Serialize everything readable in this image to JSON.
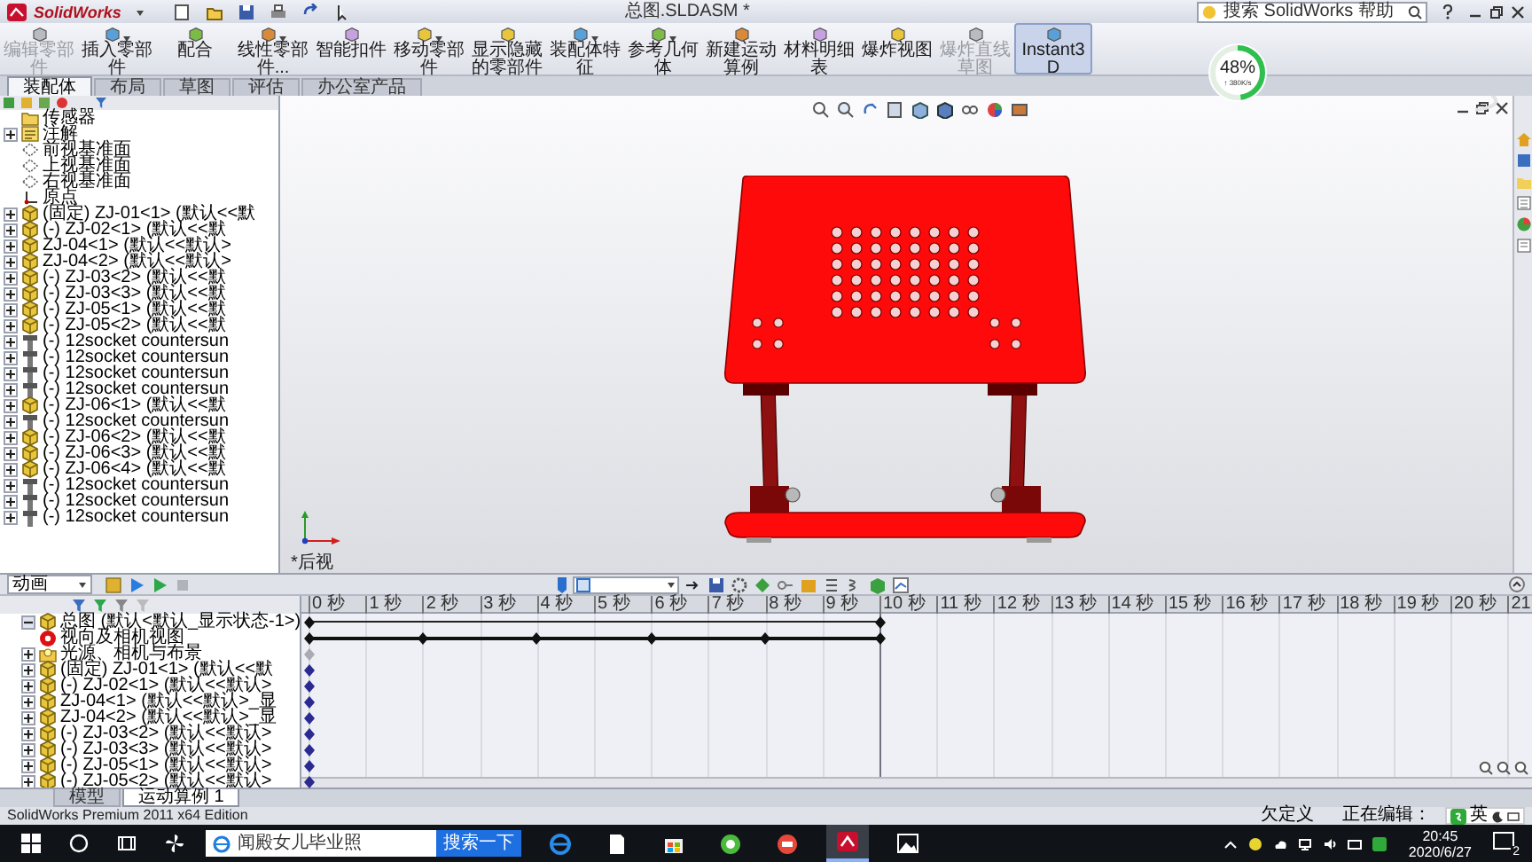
{
  "app": {
    "logo": "SolidWorks",
    "title": "总图.SLDASM *",
    "help_search": "搜索 SolidWorks 帮助"
  },
  "ribbon": [
    {
      "label": "编辑零部件",
      "disabled": true,
      "dropdown": false,
      "selected": false
    },
    {
      "label": "插入零部件",
      "disabled": false,
      "dropdown": true,
      "selected": false
    },
    {
      "label": "配合",
      "disabled": false,
      "dropdown": false,
      "selected": false
    },
    {
      "label": "线性零部件...",
      "disabled": false,
      "dropdown": true,
      "selected": false
    },
    {
      "label": "智能扣件",
      "disabled": false,
      "dropdown": false,
      "selected": false
    },
    {
      "label": "移动零部件",
      "disabled": false,
      "dropdown": true,
      "selected": false
    },
    {
      "label": "显示隐藏的零部件",
      "disabled": false,
      "dropdown": false,
      "selected": false
    },
    {
      "label": "装配体特征",
      "disabled": false,
      "dropdown": true,
      "selected": false
    },
    {
      "label": "参考几何体",
      "disabled": false,
      "dropdown": true,
      "selected": false
    },
    {
      "label": "新建运动算例",
      "disabled": false,
      "dropdown": false,
      "selected": false
    },
    {
      "label": "材料明细表",
      "disabled": false,
      "dropdown": false,
      "selected": false
    },
    {
      "label": "爆炸视图",
      "disabled": false,
      "dropdown": false,
      "selected": false
    },
    {
      "label": "爆炸直线草图",
      "disabled": true,
      "dropdown": false,
      "selected": false
    },
    {
      "label": "Instant3D",
      "disabled": false,
      "dropdown": false,
      "selected": true
    }
  ],
  "command_tabs": [
    {
      "label": "装配体",
      "selected": true
    },
    {
      "label": "布局",
      "selected": false
    },
    {
      "label": "草图",
      "selected": false
    },
    {
      "label": "评估",
      "selected": false
    },
    {
      "label": "办公室产品",
      "selected": false
    }
  ],
  "feature_tree": [
    {
      "label": "传感器",
      "kind": "folder",
      "expandable": false
    },
    {
      "label": "注解",
      "kind": "note",
      "expandable": true,
      "expanded": false
    },
    {
      "label": "前视基准面",
      "kind": "plane",
      "expandable": false
    },
    {
      "label": "上视基准面",
      "kind": "plane",
      "expandable": false
    },
    {
      "label": "右视基准面",
      "kind": "plane",
      "expandable": false
    },
    {
      "label": "原点",
      "kind": "origin",
      "expandable": false
    },
    {
      "label": "(固定) ZJ-01<1> (默认<<默",
      "kind": "part",
      "expandable": true,
      "expanded": false
    },
    {
      "label": "(-) ZJ-02<1> (默认<<默",
      "kind": "part",
      "expandable": true,
      "expanded": false
    },
    {
      "label": "ZJ-04<1> (默认<<默认>",
      "kind": "part",
      "expandable": true,
      "expanded": false
    },
    {
      "label": "ZJ-04<2> (默认<<默认>",
      "kind": "part",
      "expandable": true,
      "expanded": false
    },
    {
      "label": "(-) ZJ-03<2> (默认<<默",
      "kind": "part",
      "expandable": true,
      "expanded": false
    },
    {
      "label": "(-) ZJ-03<3> (默认<<默",
      "kind": "part",
      "expandable": true,
      "expanded": false
    },
    {
      "label": "(-) ZJ-05<1> (默认<<默",
      "kind": "part",
      "expandable": true,
      "expanded": false
    },
    {
      "label": "(-) ZJ-05<2> (默认<<默",
      "kind": "part",
      "expandable": true,
      "expanded": false
    },
    {
      "label": "(-) 12socket countersun",
      "kind": "fastener",
      "expandable": true,
      "expanded": false
    },
    {
      "label": "(-) 12socket countersun",
      "kind": "fastener",
      "expandable": true,
      "expanded": false
    },
    {
      "label": "(-) 12socket countersun",
      "kind": "fastener",
      "expandable": true,
      "expanded": false
    },
    {
      "label": "(-) 12socket countersun",
      "kind": "fastener",
      "expandable": true,
      "expanded": false
    },
    {
      "label": "(-) ZJ-06<1> (默认<<默",
      "kind": "part",
      "expandable": true,
      "expanded": false
    },
    {
      "label": "(-) 12socket countersun",
      "kind": "fastener",
      "expandable": true,
      "expanded": false
    },
    {
      "label": "(-) ZJ-06<2> (默认<<默",
      "kind": "part",
      "expandable": true,
      "expanded": false
    },
    {
      "label": "(-) ZJ-06<3> (默认<<默",
      "kind": "part",
      "expandable": true,
      "expanded": false
    },
    {
      "label": "(-) ZJ-06<4> (默认<<默",
      "kind": "part",
      "expandable": true,
      "expanded": false
    },
    {
      "label": "(-) 12socket countersun",
      "kind": "fastener",
      "expandable": true,
      "expanded": false
    },
    {
      "label": "(-) 12socket countersun",
      "kind": "fastener",
      "expandable": true,
      "expanded": false
    },
    {
      "label": "(-) 12socket countersun",
      "kind": "fastener",
      "expandable": true,
      "expanded": false
    }
  ],
  "viewport": {
    "view_label": "*后视",
    "download": {
      "percent": "48%",
      "speed": "↑ 380K/s",
      "level": 0.48
    }
  },
  "motion": {
    "study": "动画",
    "tree": [
      {
        "label": "总图 (默认<默认_显示状态-1>)",
        "kind": "assembly",
        "expandable": true,
        "expanded": true
      },
      {
        "label": "视向及相机视图",
        "kind": "camera",
        "expandable": false
      },
      {
        "label": "光源、相机与布景",
        "kind": "light",
        "expandable": true,
        "expanded": false
      },
      {
        "label": "(固定) ZJ-01<1> (默认<<默",
        "kind": "part",
        "expandable": true,
        "expanded": false
      },
      {
        "label": "(-) ZJ-02<1> (默认<<默认>",
        "kind": "part",
        "expandable": true,
        "expanded": false
      },
      {
        "label": "ZJ-04<1> (默认<<默认>_显",
        "kind": "part",
        "expandable": true,
        "expanded": false
      },
      {
        "label": "ZJ-04<2> (默认<<默认>_显",
        "kind": "part",
        "expandable": true,
        "expanded": false
      },
      {
        "label": "(-) ZJ-03<2> (默认<<默认>",
        "kind": "part",
        "expandable": true,
        "expanded": false
      },
      {
        "label": "(-) ZJ-03<3> (默认<<默认>",
        "kind": "part",
        "expandable": true,
        "expanded": false
      },
      {
        "label": "(-) ZJ-05<1> (默认<<默认>",
        "kind": "part",
        "expandable": true,
        "expanded": false
      },
      {
        "label": "(-) ZJ-05<2> (默认<<默认>",
        "kind": "part",
        "expandable": true,
        "expanded": false
      }
    ],
    "tracks": [
      {
        "kind": "span"
      },
      {
        "kind": "steps"
      },
      {
        "kind": "muted"
      },
      {
        "kind": "key"
      },
      {
        "kind": "key"
      },
      {
        "kind": "key"
      },
      {
        "kind": "key"
      },
      {
        "kind": "key"
      },
      {
        "kind": "key"
      },
      {
        "kind": "key"
      },
      {
        "kind": "key"
      }
    ],
    "ruler": [
      "0 秒",
      "1 秒",
      "2 秒",
      "3 秒",
      "4 秒",
      "5 秒",
      "6 秒",
      "7 秒",
      "8 秒",
      "9 秒",
      "10 秒",
      "11 秒",
      "12 秒",
      "13 秒",
      "14 秒",
      "15 秒",
      "16 秒",
      "17 秒",
      "18 秒",
      "19 秒",
      "20 秒",
      "21"
    ],
    "tabs": [
      {
        "label": "模型",
        "selected": false
      },
      {
        "label": "运动算例 1",
        "selected": true
      }
    ]
  },
  "status_bar": {
    "edition": "SolidWorks Premium 2011 x64 Edition",
    "state": "欠定义",
    "mode": "正在编辑：",
    "ime": "英"
  },
  "taskbar": {
    "search_text": "闻殿女儿毕业照",
    "search_button": "搜索一下",
    "time": "20:45",
    "date": "2020/6/27",
    "notifications": "2"
  }
}
